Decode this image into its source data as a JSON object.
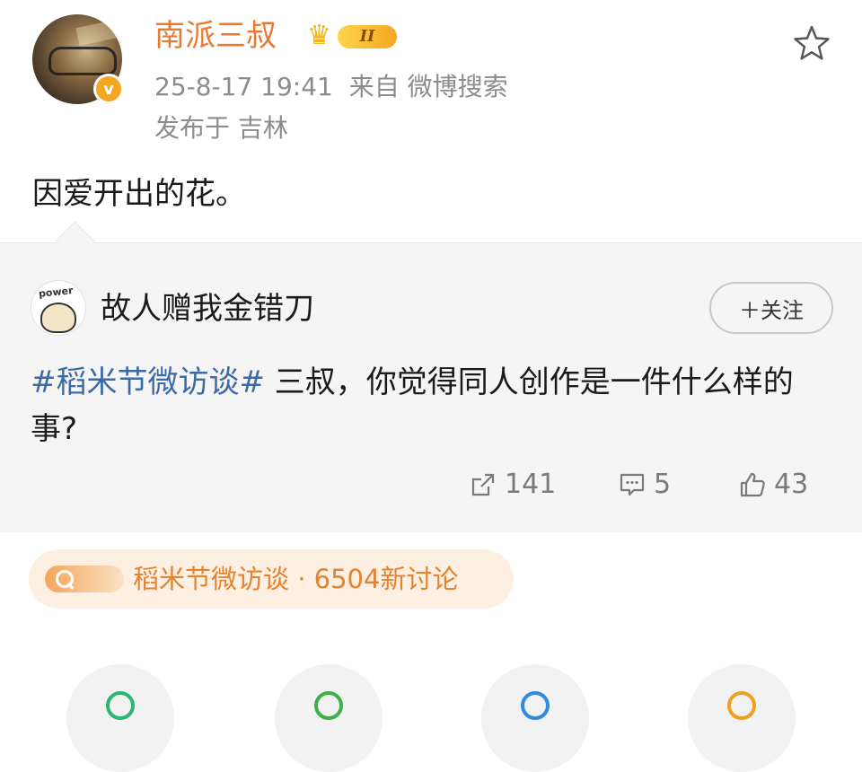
{
  "post": {
    "author": "南派三叔",
    "vip_level": "II",
    "verified_mark": "v",
    "timestamp": "25-8-17 19:41",
    "source": "来自 微博搜索",
    "location": "发布于 吉林",
    "text": "因爱开出的花。",
    "star_icon": "star-outline-icon"
  },
  "quoted": {
    "author": "故人赠我金错刀",
    "avatar_text": "power",
    "follow_label": "＋关注",
    "hashtag": "#稻米节微访谈#",
    "text": " 三叔，你觉得同人创作是一件什么样的事?",
    "stats": {
      "reposts": "141",
      "comments": "5",
      "likes": "43"
    }
  },
  "topic": {
    "label": "稻米节微访谈 · 6504新讨论"
  },
  "colors": {
    "username": "#eb7a2f",
    "hashtag": "#3b6aa6",
    "topic_text": "#e2832f",
    "topic_bg": "#fdf0e3",
    "meta_text": "#8c8c8c"
  }
}
